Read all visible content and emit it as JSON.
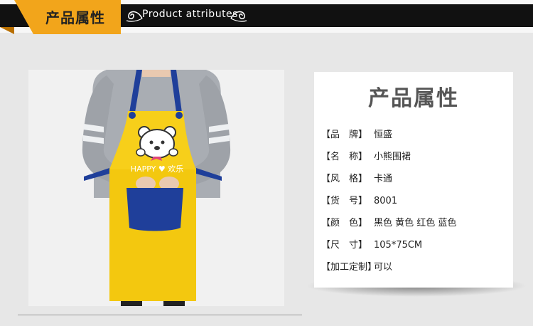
{
  "banner": {
    "title_cn": "产品属性",
    "title_en": "Product attributes"
  },
  "photo": {
    "apron_text": "HAPPY ♥ 欢乐"
  },
  "card": {
    "title": "产品属性",
    "rows": [
      {
        "label": "【品　牌】",
        "value": "恒盛"
      },
      {
        "label": "【名　称】",
        "value": "小熊围裙"
      },
      {
        "label": "【风　格】",
        "value": "卡通"
      },
      {
        "label": "【货　号】",
        "value": "8001"
      },
      {
        "label": "【颜　色】",
        "value": "黑色 黄色 红色 蓝色"
      },
      {
        "label": "【尺　寸】",
        "value": "105*75CM"
      },
      {
        "label": "【加工定制】",
        "value": "可以"
      }
    ]
  },
  "colors": {
    "banner_black": "#111111",
    "tag_orange": "#f2a51b",
    "apron_yellow": "#f7cf1a",
    "apron_blue": "#1f3f9a"
  }
}
